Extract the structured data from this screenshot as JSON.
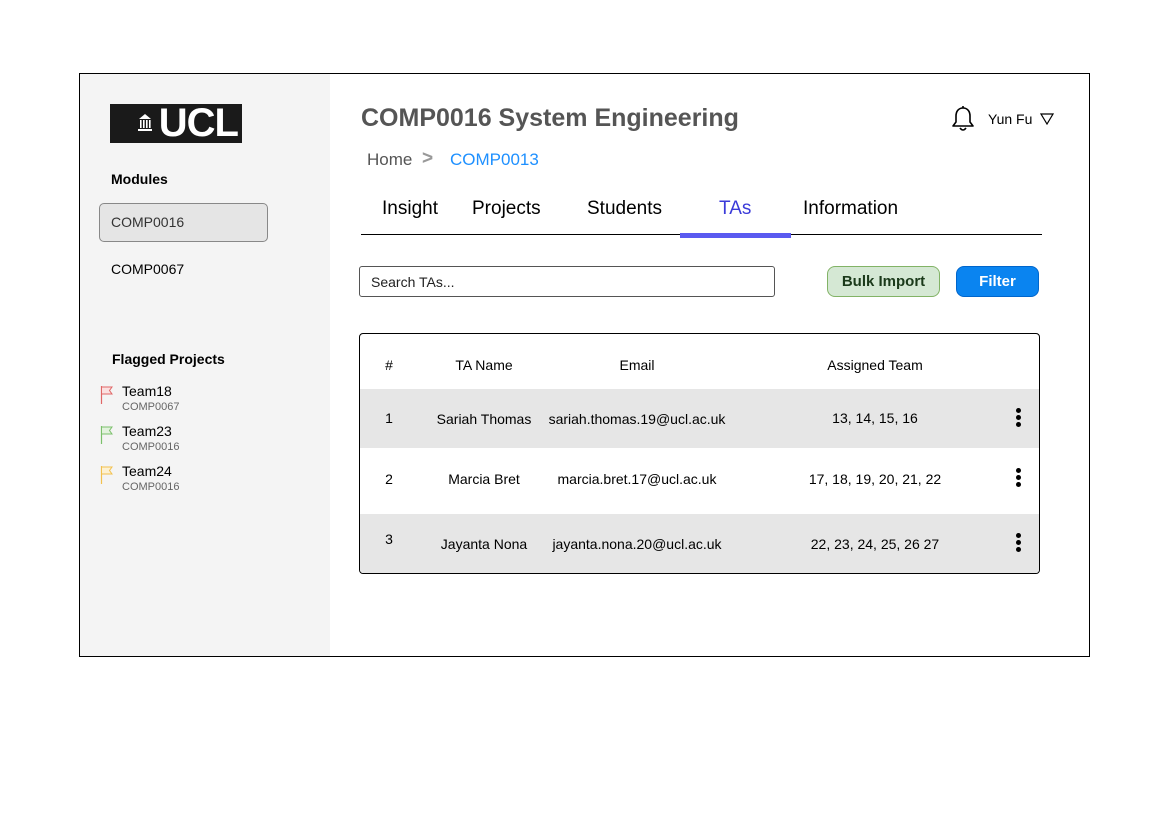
{
  "sidebar": {
    "logo_text": "UCL",
    "modules_title": "Modules",
    "modules": [
      {
        "label": "COMP0016",
        "active": true
      },
      {
        "label": "COMP0067",
        "active": false
      }
    ],
    "flagged_title": "Flagged Projects",
    "flagged": [
      {
        "team": "Team18",
        "module": "COMP0067",
        "color": "#e06666"
      },
      {
        "team": "Team23",
        "module": "COMP0016",
        "color": "#7bc06b"
      },
      {
        "team": "Team24",
        "module": "COMP0016",
        "color": "#f2c14e"
      }
    ]
  },
  "header": {
    "title": "COMP0016 System Engineering",
    "user_name": "Yun Fu",
    "notification_icon": "bell-icon",
    "user_menu_icon": "triangle-down-icon"
  },
  "breadcrumb": {
    "home": "Home",
    "separator": ">",
    "current": "COMP0013"
  },
  "tabs": [
    {
      "label": "Insight",
      "active": false
    },
    {
      "label": "Projects",
      "active": false
    },
    {
      "label": "Students",
      "active": false
    },
    {
      "label": "TAs",
      "active": true
    },
    {
      "label": "Information",
      "active": false
    }
  ],
  "search": {
    "placeholder": "Search TAs..."
  },
  "buttons": {
    "bulk_import": "Bulk Import",
    "filter": "Filter"
  },
  "table": {
    "headers": [
      "#",
      "TA Name",
      "Email",
      "Assigned Team"
    ],
    "rows": [
      {
        "num": "1",
        "name": "Sariah Thomas",
        "email": "sariah.thomas.19@ucl.ac.uk",
        "teams": "13, 14, 15, 16"
      },
      {
        "num": "2",
        "name": "Marcia Bret",
        "email": "marcia.bret.17@ucl.ac.uk",
        "teams": "17, 18, 19, 20, 21, 22"
      },
      {
        "num": "3",
        "name": "Jayanta Nona",
        "email": "jayanta.nona.20@ucl.ac.uk",
        "teams": "22, 23, 24, 25, 26 27"
      }
    ],
    "row_action_icon": "more-vertical-icon"
  },
  "colors": {
    "accent": "#0a84f0",
    "active_tab": "#3b3bd9",
    "breadcrumb_link": "#1e90ff",
    "bulk_import_bg": "#d5e8d4"
  }
}
